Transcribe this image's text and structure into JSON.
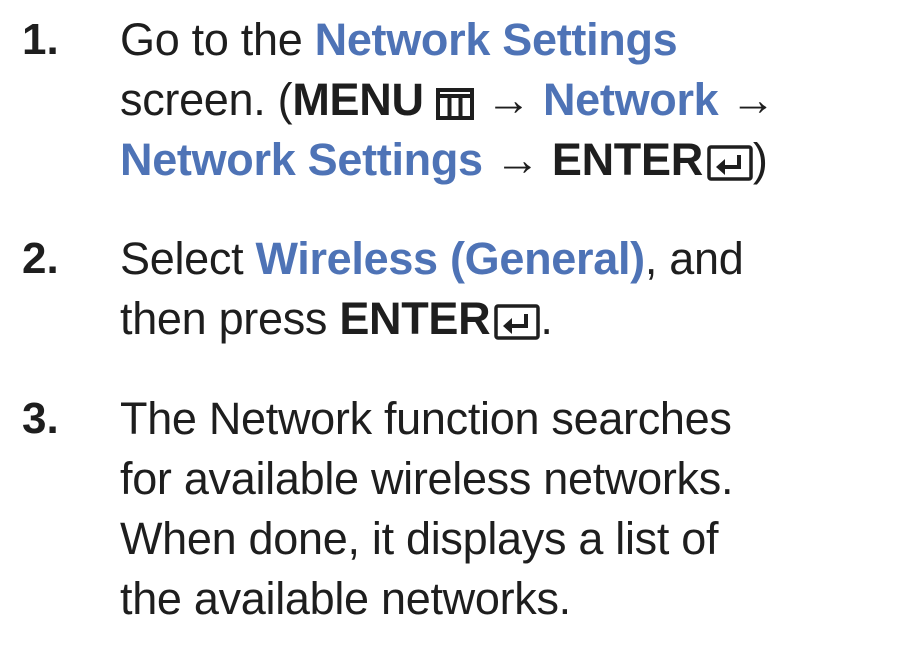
{
  "steps": [
    {
      "number": "1.",
      "line1_pre": "Go to the ",
      "line1_link": "Network Settings",
      "line2_pre": "screen. (",
      "line2_menu": "MENU",
      "arrow": "→",
      "line2_link": "Network",
      "line3_link": "Network Settings",
      "line3_enter": "ENTER",
      "line3_close": ")"
    },
    {
      "number": "2.",
      "line1_pre": "Select ",
      "line1_link": "Wireless (General)",
      "line1_post": ", and",
      "line2_pre": "then press ",
      "line2_enter": "ENTER",
      "line2_post": "."
    },
    {
      "number": "3.",
      "lines": [
        "The Network function searches",
        "for available wireless networks.",
        "When done, it displays a list of",
        "the available networks."
      ]
    }
  ],
  "icons": {
    "menu": "menu-icon",
    "enter": "enter-icon"
  },
  "colors": {
    "link": "#4e73b6",
    "text": "#1e1e1e"
  }
}
